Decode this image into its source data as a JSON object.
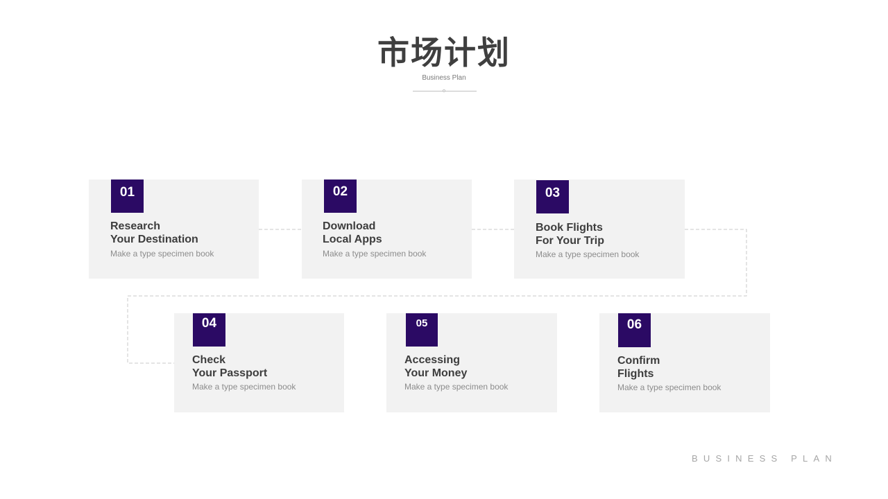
{
  "header": {
    "title": "市场计划",
    "subtitle": "Business Plan"
  },
  "steps": [
    {
      "number": "01",
      "line1": "Research",
      "line2": "Your Destination",
      "description": "Make a type specimen book"
    },
    {
      "number": "02",
      "line1": "Download",
      "line2": "Local Apps",
      "description": "Make a type specimen book"
    },
    {
      "number": "03",
      "line1": "Book Flights",
      "line2": "For Your Trip",
      "description": "Make a type specimen book"
    },
    {
      "number": "04",
      "line1": "Check",
      "line2": "Your Passport",
      "description": "Make a type specimen book"
    },
    {
      "number": "05",
      "line1": "Accessing",
      "line2": "Your Money",
      "description": "Make a type specimen book"
    },
    {
      "number": "06",
      "line1": "Confirm",
      "line2": "Flights",
      "description": "Make a type specimen book"
    }
  ],
  "footer": {
    "text": "BUSINESS PLAN"
  },
  "colors": {
    "accent": "#2b0a64",
    "card_background": "#f2f2f2",
    "heading_text": "#3d3d3d",
    "muted_text": "#8c8c8c"
  }
}
